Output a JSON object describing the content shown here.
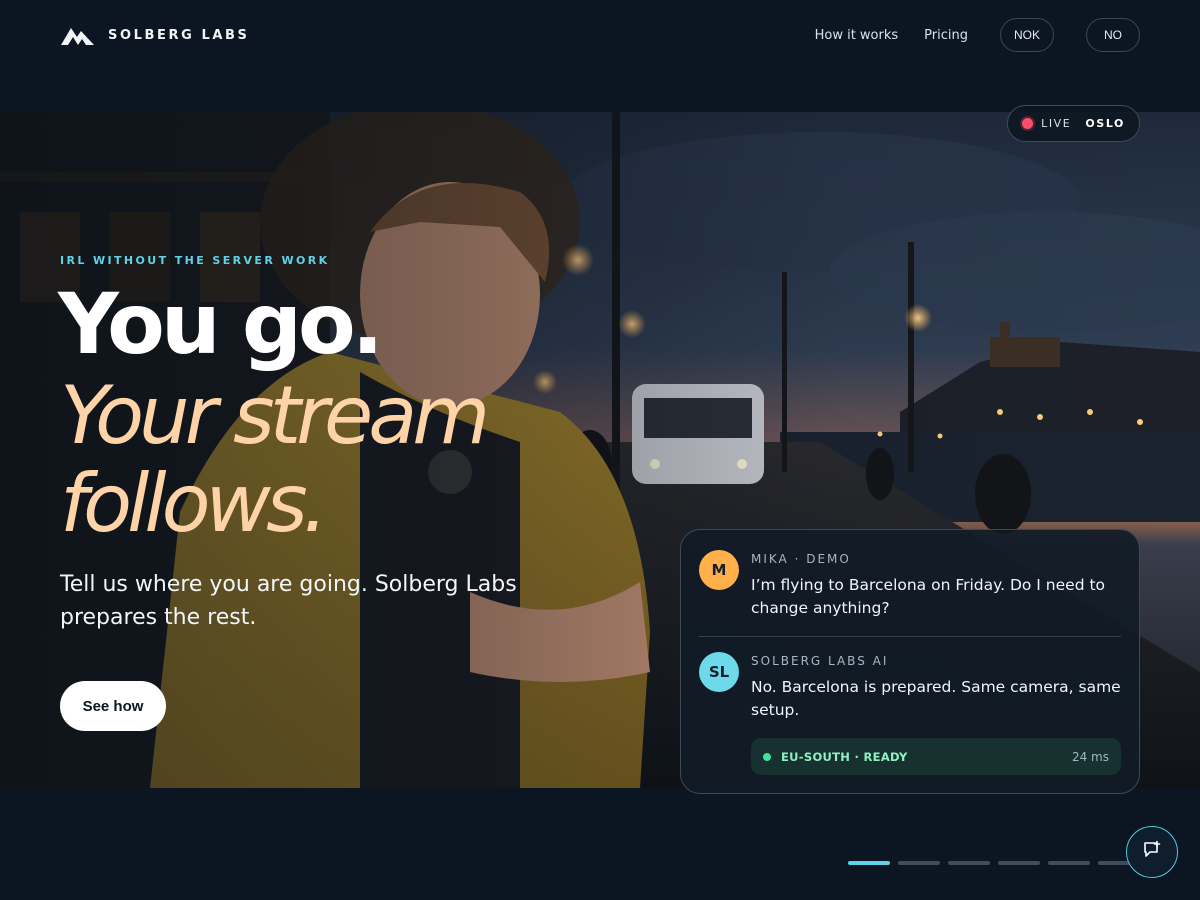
{
  "header": {
    "brand": "SOLBERG LABS",
    "nav": [
      {
        "label": "How it works"
      },
      {
        "label": "Pricing"
      }
    ],
    "currency": "NOK",
    "language": "NO"
  },
  "hero": {
    "live_label": "LIVE",
    "live_city": "OSLO",
    "eyebrow": "IRL WITHOUT THE SERVER WORK",
    "headline_1": "You go.",
    "headline_2": "Your stream follows.",
    "subtitle": "Tell us where you are going. Solberg Labs prepares the rest.",
    "cta": "See how"
  },
  "chat": {
    "messages": [
      {
        "initials": "M",
        "author": "MIKA · DEMO",
        "text": "I’m flying to Barcelona on Friday. Do I need to change anything?"
      },
      {
        "initials": "SL",
        "author": "SOLBERG LABS AI",
        "text": "No. Barcelona is prepared. Same camera, same setup."
      }
    ],
    "status": {
      "region": "EU-SOUTH · READY",
      "latency": "24 ms"
    }
  },
  "carousel": {
    "count": 6,
    "active_index": 0
  },
  "colors": {
    "background": "#0b1622",
    "accent": "#5fd2e8",
    "headline_accent": "#ffd3a8",
    "live": "#ff4d6a",
    "ready": "#41e29a"
  },
  "icons": {
    "brand": "mountain-logo-icon",
    "live": "live-dot-icon",
    "fab": "chat-bubble-icon"
  }
}
